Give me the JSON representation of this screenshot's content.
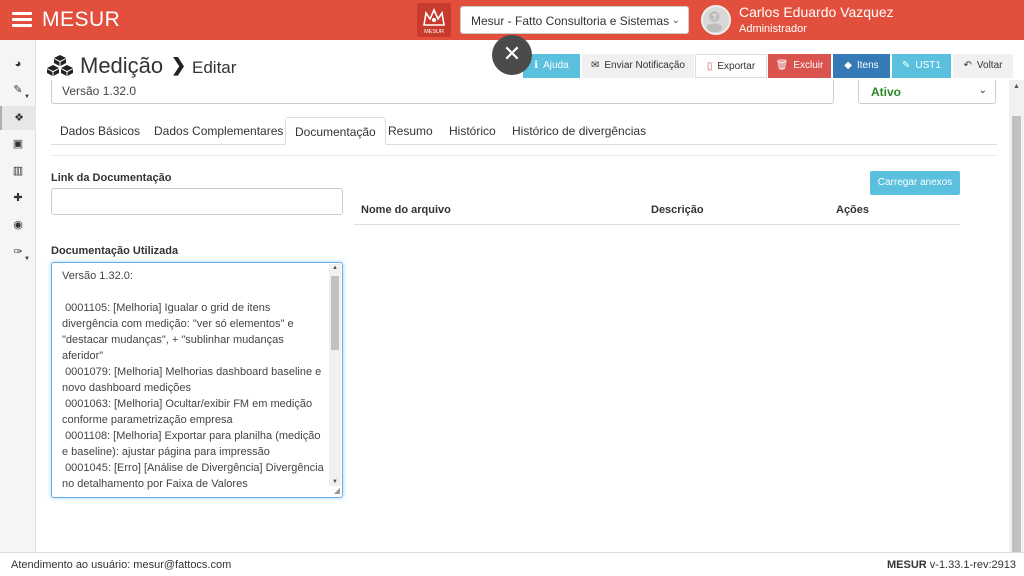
{
  "app": {
    "brand": "MESUR",
    "logo_text": "MESUR"
  },
  "header": {
    "company_selected": "Mesur - Fatto Consultoria e Sistemas",
    "user_name": "Carlos Eduardo Vazquez",
    "user_role": "Administrador"
  },
  "sidebar": {
    "items": [
      {
        "icon": "dashboard-icon",
        "glyph": "◕"
      },
      {
        "icon": "pencil-icon",
        "glyph": "✎"
      },
      {
        "icon": "cubes-icon",
        "glyph": "❖"
      },
      {
        "icon": "image-icon",
        "glyph": "▣"
      },
      {
        "icon": "bank-icon",
        "glyph": "▥"
      },
      {
        "icon": "puzzle-icon",
        "glyph": "✚"
      },
      {
        "icon": "target-icon",
        "glyph": "◉"
      },
      {
        "icon": "wrench-icon",
        "glyph": "✑"
      }
    ]
  },
  "page": {
    "title": "Medição",
    "subtitle": "Editar",
    "close_glyph": "✕"
  },
  "toolbar": {
    "ajuda": "Ajuda",
    "notificacao": "Enviar Notificação",
    "exportar": "Exportar",
    "excluir": "Excluir",
    "itens": "Itens",
    "ust": "UST1",
    "voltar": "Voltar"
  },
  "form": {
    "version_value": "Versão 1.32.0",
    "status_value": "Ativo"
  },
  "tabs": [
    {
      "label": "Dados Básicos"
    },
    {
      "label": "Dados Complementares"
    },
    {
      "label": "Documentação"
    },
    {
      "label": "Resumo"
    },
    {
      "label": "Histórico"
    },
    {
      "label": "Histórico de divergências"
    }
  ],
  "documentacao": {
    "link_label": "Link da Documentação",
    "link_value": "",
    "upload_button": "Carregar anexos",
    "table_headers": [
      "Nome do arquivo",
      "Descrição",
      "Ações"
    ],
    "used_label": "Documentação Utilizada",
    "used_text": "Versão 1.32.0:\n\n 0001105: [Melhoria] Igualar o grid de itens divergência com medição: \"ver só elementos\" e \"destacar mudanças\", + \"sublinhar mudanças aferidor\"\n 0001079: [Melhoria] Melhorias dashboard baseline e novo dashboard medições\n 0001063: [Melhoria] Ocultar/exibir FM em medição conforme parametrização empresa\n 0001108: [Melhoria] Exportar para planilha (medição e baseline): ajustar página para impressão\n 0001045: [Erro] [Análise de Divergência] Divergência no detalhamento por Faixa de Valores"
  },
  "footer": {
    "support": "Atendimento ao usuário: mesur@fattocs.com",
    "brand": "MESUR",
    "version": " v-1.33.1-rev:2913"
  },
  "colors": {
    "topbar": "#e2503d",
    "info": "#5bc0de",
    "danger": "#d9534f",
    "primary": "#337ab7",
    "status_active": "#2a8a2a"
  }
}
